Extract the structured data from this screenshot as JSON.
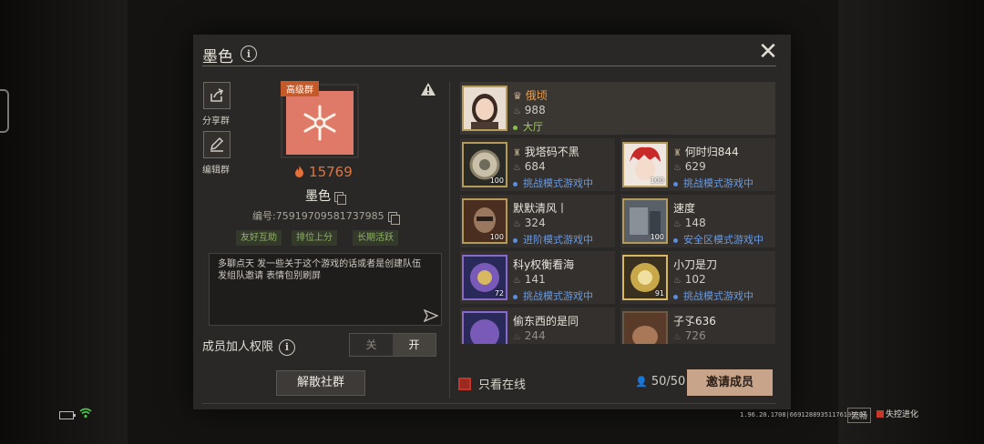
{
  "header": {
    "title": "墨色",
    "close_icon": "close-icon"
  },
  "sidebar": {
    "share_label": "分享群",
    "edit_label": "编辑群"
  },
  "group": {
    "badge": "高级群",
    "heat": "15769",
    "name": "墨色",
    "id_text": "编号:75919709581737985",
    "tags": [
      "友好互助",
      "排位上分",
      "长期活跃"
    ],
    "description": "多聊点天 发一些关于这个游戏的话或者是创建队伍 发组队邀请   表情包别刷屏"
  },
  "permission": {
    "label": "成员加人权限",
    "off": "关",
    "on": "开",
    "selected": "开"
  },
  "disband_label": "解散社群",
  "members": [
    {
      "name": "俄顷",
      "heat": "988",
      "status": "大厅"
    },
    {
      "name": "我塔码不黑",
      "heat": "684",
      "status": "挑战模式游戏中",
      "level": "100"
    },
    {
      "name": "何时归844",
      "heat": "629",
      "status": "挑战模式游戏中",
      "level": "100"
    },
    {
      "name": "默默清风丨",
      "heat": "324",
      "status": "进阶模式游戏中",
      "level": "100"
    },
    {
      "name": "速度",
      "heat": "148",
      "status": "安全区模式游戏中",
      "level": "100"
    },
    {
      "name": "科y权衡看海",
      "heat": "141",
      "status": "挑战模式游戏中",
      "level": "72"
    },
    {
      "name": "小刀是刀",
      "heat": "102",
      "status": "挑战模式游戏中",
      "level": "91"
    },
    {
      "name": "偷东西的是同",
      "heat": "244"
    },
    {
      "name": "子孓636",
      "heat": "726"
    }
  ],
  "footer": {
    "only_online": "只看在线",
    "member_count": "50/50",
    "invite_label": "邀请成员",
    "version": "1.96.20.1708|66912889351176195",
    "fluency": "流畅",
    "brand": "失控进化"
  },
  "colors": {
    "heat": "#e5713a",
    "status_blue": "#6a9ae0",
    "status_green": "#a6d060",
    "invite_bg": "#c8a58a"
  }
}
